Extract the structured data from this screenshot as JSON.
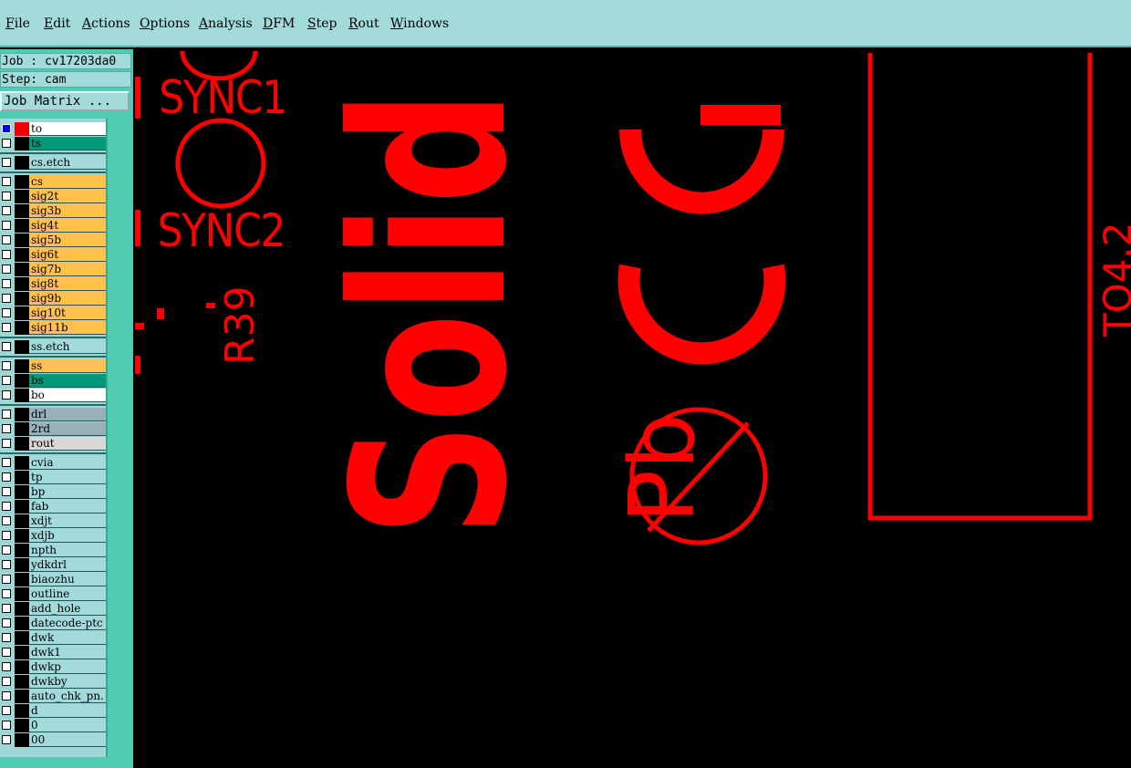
{
  "menu": [
    "File",
    "Edit",
    "Actions",
    "Options",
    "Analysis",
    "DFM",
    "Step",
    "Rout",
    "Windows"
  ],
  "job": {
    "label": "Job : cv17203da0",
    "step": "Step: cam",
    "matrix_button": "Job Matrix ..."
  },
  "layers": [
    {
      "name": "to",
      "color": "#ffffff",
      "checked": true,
      "red": true
    },
    {
      "name": "ts",
      "color": "#009a7a"
    },
    {
      "name": "cs.etch",
      "color": "#a3dada",
      "gap": true
    },
    {
      "name": "cs",
      "color": "#ffc050",
      "gap": true
    },
    {
      "name": "sig2t",
      "color": "#ffc050"
    },
    {
      "name": "sig3b",
      "color": "#ffc050"
    },
    {
      "name": "sig4t",
      "color": "#ffc050"
    },
    {
      "name": "sig5b",
      "color": "#ffc050"
    },
    {
      "name": "sig6t",
      "color": "#ffc050"
    },
    {
      "name": "sig7b",
      "color": "#ffc050"
    },
    {
      "name": "sig8t",
      "color": "#ffc050"
    },
    {
      "name": "sig9b",
      "color": "#ffc050"
    },
    {
      "name": "sig10t",
      "color": "#ffc050"
    },
    {
      "name": "sig11b",
      "color": "#ffc050"
    },
    {
      "name": "ss.etch",
      "color": "#a3dada",
      "gap": true
    },
    {
      "name": "ss",
      "color": "#ffc050",
      "gap": true
    },
    {
      "name": "bs",
      "color": "#009a7a"
    },
    {
      "name": "bo",
      "color": "#ffffff"
    },
    {
      "name": "drl",
      "color": "#98b0b8",
      "gap": true
    },
    {
      "name": "2rd",
      "color": "#98b0b8"
    },
    {
      "name": "rout",
      "color": "#d8d8d8"
    },
    {
      "name": "cvia",
      "color": "#a3dada",
      "gap": true
    },
    {
      "name": "tp",
      "color": "#a3dada"
    },
    {
      "name": "bp",
      "color": "#a3dada"
    },
    {
      "name": "fab",
      "color": "#a3dada"
    },
    {
      "name": "xdjt",
      "color": "#a3dada"
    },
    {
      "name": "xdjb",
      "color": "#a3dada"
    },
    {
      "name": "npth",
      "color": "#a3dada"
    },
    {
      "name": "ydkdrl",
      "color": "#a3dada"
    },
    {
      "name": "biaozhu",
      "color": "#a3dada"
    },
    {
      "name": "outline",
      "color": "#a3dada"
    },
    {
      "name": "add_hole",
      "color": "#a3dada"
    },
    {
      "name": "datecode-ptc",
      "color": "#a3dada"
    },
    {
      "name": "dwk",
      "color": "#a3dada"
    },
    {
      "name": "dwk1",
      "color": "#a3dada"
    },
    {
      "name": "dwkp",
      "color": "#a3dada"
    },
    {
      "name": "dwkby",
      "color": "#a3dada"
    },
    {
      "name": "auto_chk_pn.",
      "color": "#a3dada"
    },
    {
      "name": "d",
      "color": "#a3dada"
    },
    {
      "name": "0",
      "color": "#a3dada"
    },
    {
      "name": "00",
      "color": "#a3dada"
    }
  ],
  "canvas": {
    "sync1": "SYNC1",
    "sync2": "SYNC2",
    "r39": "R39",
    "solid": "Solid",
    "ce": "CE",
    "pb": "Pb",
    "edge_text": "TO4.2",
    "stroke_color": "#ff0000"
  }
}
